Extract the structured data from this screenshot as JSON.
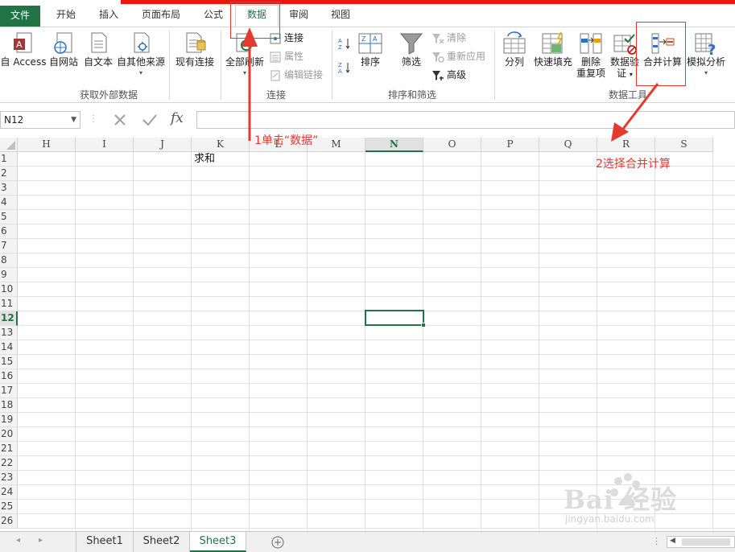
{
  "ribbon_tabs": [
    "文件",
    "开始",
    "插入",
    "页面布局",
    "公式",
    "数据",
    "审阅",
    "视图"
  ],
  "active_tab": "数据",
  "ribbon": {
    "get_external": {
      "group_label": "获取外部数据",
      "from_access": "自 Access",
      "from_web": "自网站",
      "from_text": "自文本",
      "from_other": "自其他来源",
      "existing_connections": "现有连接"
    },
    "connections": {
      "group_label": "连接",
      "refresh_all": "全部刷新",
      "connections": "连接",
      "properties": "属性",
      "edit_links": "编辑链接"
    },
    "sort_filter": {
      "group_label": "排序和筛选",
      "sort": "排序",
      "filter": "筛选",
      "clear": "清除",
      "reapply": "重新应用",
      "advanced": "高级"
    },
    "data_tools": {
      "group_label": "数据工具",
      "text_to_columns": "分列",
      "flash_fill": "快速填充",
      "remove_duplicates_l1": "删除",
      "remove_duplicates_l2": "重复项",
      "validation_l1": "数据验",
      "validation_l2": "证",
      "consolidate": "合并计算",
      "what_if": "模拟分析"
    }
  },
  "formula_bar": {
    "name_box": "N12",
    "fx_label": "fx",
    "formula": ""
  },
  "columns": [
    "H",
    "I",
    "J",
    "K",
    "L",
    "M",
    "N",
    "O",
    "P",
    "Q",
    "R",
    "S"
  ],
  "selected_column": "N",
  "rows": [
    "1",
    "2",
    "3",
    "4",
    "5",
    "6",
    "7",
    "8",
    "9",
    "10",
    "11",
    "12",
    "13",
    "14",
    "15",
    "16",
    "17",
    "18",
    "19",
    "20",
    "21",
    "22",
    "23",
    "24",
    "25",
    "26"
  ],
  "selected_row": "12",
  "cells": {
    "K1": "求和"
  },
  "sheet_tabs": [
    "Sheet1",
    "Sheet2",
    "Sheet3"
  ],
  "active_sheet": "Sheet3",
  "annotations": {
    "step1": "1单击“数据”",
    "step2": "2选择合并计算"
  },
  "watermark": {
    "main": "Bai 经验",
    "sub": "jingyan.baidu.com"
  },
  "colors": {
    "excel_green": "#217346",
    "annotation_red": "#e53a2f",
    "top_strip_red": "#e8180c"
  }
}
